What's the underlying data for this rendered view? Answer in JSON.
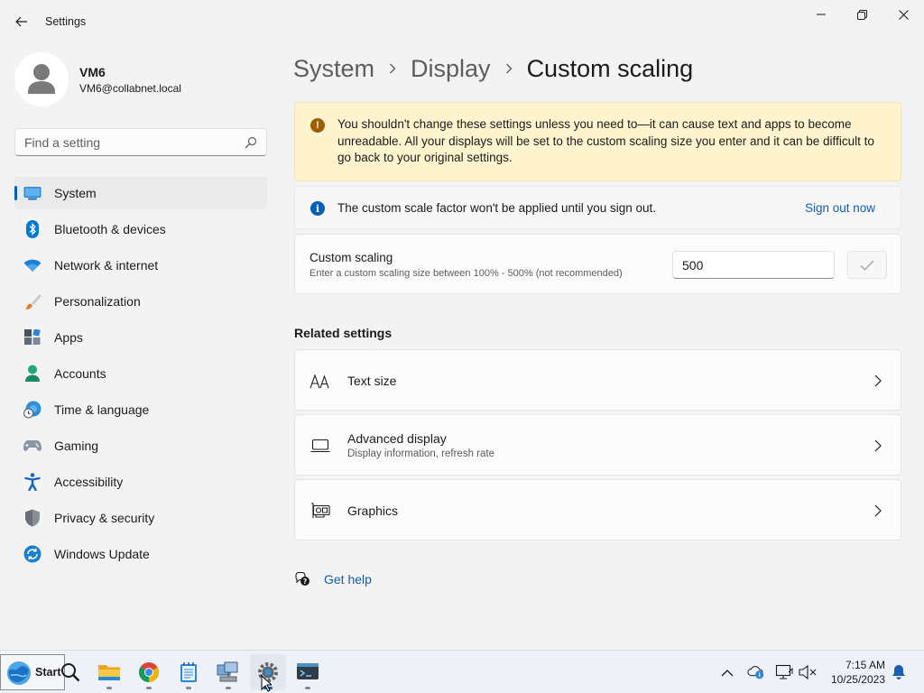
{
  "window": {
    "title": "Settings"
  },
  "profile": {
    "name": "VM6",
    "email": "VM6@collabnet.local"
  },
  "search": {
    "placeholder": "Find a setting"
  },
  "nav": {
    "items": [
      {
        "label": "System",
        "icon": "system-icon",
        "active": true
      },
      {
        "label": "Bluetooth & devices",
        "icon": "bluetooth-icon"
      },
      {
        "label": "Network & internet",
        "icon": "wifi-icon"
      },
      {
        "label": "Personalization",
        "icon": "brush-icon"
      },
      {
        "label": "Apps",
        "icon": "apps-icon"
      },
      {
        "label": "Accounts",
        "icon": "accounts-icon"
      },
      {
        "label": "Time & language",
        "icon": "globe-clock-icon"
      },
      {
        "label": "Gaming",
        "icon": "controller-icon"
      },
      {
        "label": "Accessibility",
        "icon": "accessibility-icon"
      },
      {
        "label": "Privacy & security",
        "icon": "shield-icon"
      },
      {
        "label": "Windows Update",
        "icon": "update-icon"
      }
    ]
  },
  "breadcrumb": {
    "items": [
      "System",
      "Display"
    ],
    "current": "Custom scaling"
  },
  "warning": {
    "text": "You shouldn't change these settings unless you need to—it can cause text and apps to become unreadable. All your displays will be set to the custom scaling size you enter and it can be difficult to go back to your original settings."
  },
  "info": {
    "text": "The custom scale factor won't be applied until you sign out.",
    "action": "Sign out now"
  },
  "custom_scaling": {
    "title": "Custom scaling",
    "subtitle": "Enter a custom scaling size between 100% - 500% (not recommended)",
    "value": "500"
  },
  "related": {
    "heading": "Related settings",
    "items": [
      {
        "title": "Text size",
        "subtitle": "",
        "icon": "text-size-icon"
      },
      {
        "title": "Advanced display",
        "subtitle": "Display information, refresh rate",
        "icon": "monitor-icon"
      },
      {
        "title": "Graphics",
        "subtitle": "",
        "icon": "graphics-card-icon"
      }
    ]
  },
  "help": {
    "label": "Get help"
  },
  "taskbar": {
    "start_label": "Start",
    "apps": [
      "search-icon",
      "file-explorer-icon",
      "chrome-icon",
      "notepad-icon",
      "network-computer-icon",
      "settings-icon",
      "terminal-icon"
    ],
    "time": "7:15 AM",
    "date": "10/25/2023"
  },
  "colors": {
    "accent": "#005fb8",
    "link": "#0f5fb4",
    "warning_bg": "#fff4ce",
    "warning_icon": "#9d5d00"
  }
}
